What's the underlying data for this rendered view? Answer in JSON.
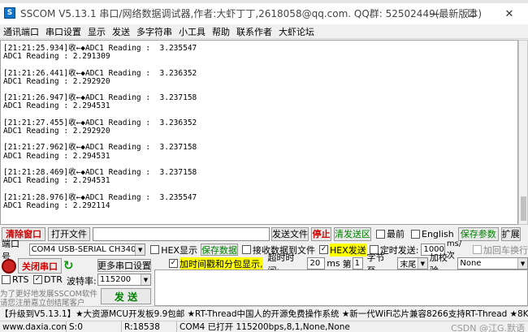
{
  "window": {
    "title": "SSCOM V5.13.1 串口/网络数据调试器,作者:大虾丁丁,2618058@qq.com. QQ群: 52502449(最新版本)",
    "app_icon": "S",
    "minimize": "—",
    "maximize": "☐",
    "close": "✕"
  },
  "menu": [
    "通讯端口",
    "串口设置",
    "显示",
    "发送",
    "多字符串",
    "小工具",
    "帮助",
    "联系作者",
    "大虾论坛"
  ],
  "receive_text": "[21:21:25.934]收←◆ADC1 Reading :  3.235547\nADC1 Reading : 2.291309\n\n[21:21:26.441]收←◆ADC1 Reading :  3.236352\nADC1 Reading : 2.292920\n\n[21:21:26.947]收←◆ADC1 Reading :  3.237158\nADC1 Reading : 2.294531\n\n[21:21:27.455]收←◆ADC1 Reading :  3.236352\nADC1 Reading : 2.292920\n\n[21:21:27.962]收←◆ADC1 Reading :  3.237158\nADC1 Reading : 2.294531\n\n[21:21:28.469]收←◆ADC1 Reading :  3.237158\nADC1 Reading : 2.294531\n\n[21:21:28.976]收←◆ADC1 Reading :  3.235547\nADC1 Reading : 2.292114",
  "row1": {
    "clear_window": "清除窗口",
    "open_file": "打开文件",
    "send_file": "发送文件",
    "stop": "停止",
    "clear_send": "清发送区",
    "latest": "最前",
    "english": "English",
    "save_params": "保存参数",
    "expand": "扩展"
  },
  "row2": {
    "port_label": "端口号",
    "port_value": "COM4 USB-SERIAL CH340",
    "hex_display": "HEX显示",
    "save_data": "保存数据",
    "recv_to_file": "接收数据到文件",
    "hex_send": "HEX发送",
    "timed_send": "定时发送:",
    "interval": "1000",
    "interval_unit": "ms/次",
    "add_crlf": "加回车换行"
  },
  "row3": {
    "close_port": "关闭串口",
    "more_settings": "更多串口设置",
    "timestamp": "加时间戳和分包显示,",
    "timeout_label": "超时时间:",
    "timeout": "20",
    "timeout_unit": "ms",
    "nth_label": "第",
    "nth": "1",
    "byte_label": "字节 至",
    "to_value": "末尾",
    "checksum_label": "加校验",
    "checksum_value": "None"
  },
  "row4": {
    "rts": "RTS",
    "dtr": "DTR",
    "baud_label": "波特率:",
    "baud_value": "115200"
  },
  "left_note_1": "为了更好地发展SSCOM软件",
  "left_note_2": "请您注册嘉立创结尾客户",
  "send_button": "发 送",
  "ticker": "【升级到V5.13.1】★大资源MCU开发板9.9包邮 ★RT-Thread中国人的开源免费操作系统 ★新一代WiFi芯片兼容8266支持RT-Thread ★8KM远距离",
  "status": {
    "site": "www.daxia.com",
    "sent": "S:0",
    "received": "R:18538",
    "port_state": "COM4 已打开  115200bps,8,1,None,None",
    "watermark": "CSDN @江G.默语"
  }
}
